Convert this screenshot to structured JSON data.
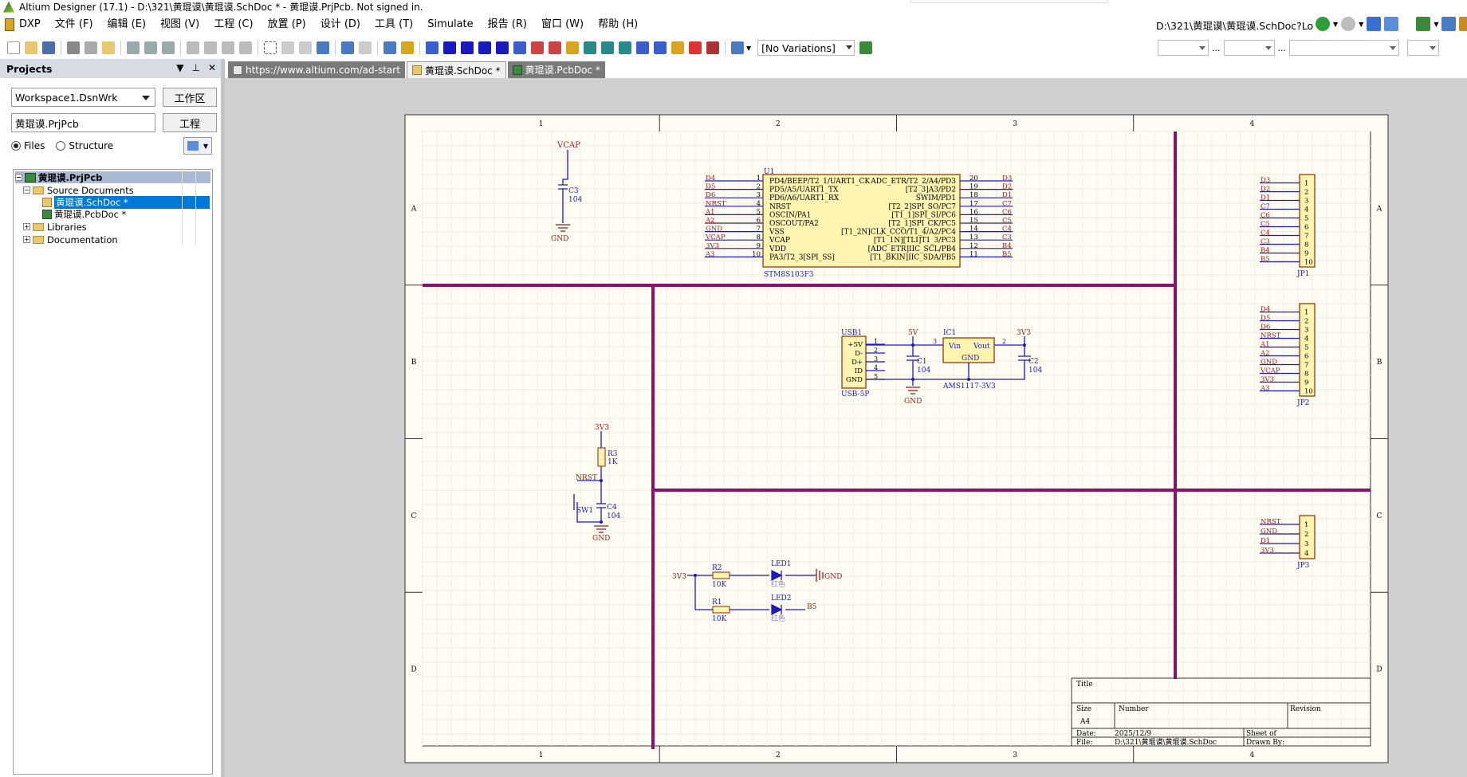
{
  "window": {
    "title": "Altium Designer (17.1) - D:\\321\\黄琨谟\\黄琨谟.SchDoc * - 黄琨谟.PrjPcb. Not signed in."
  },
  "menu": [
    "DXP",
    "文件 (F)",
    "编辑 (E)",
    "视图 (V)",
    "工程 (C)",
    "放置 (P)",
    "设计 (D)",
    "工具 (T)",
    "Simulate",
    "报告 (R)",
    "窗口 (W)",
    "帮助 (H)"
  ],
  "nav_path": "D:\\321\\黄琨谟\\黄琨谟.SchDoc?Lo",
  "toolbar": {
    "variations": "[No Variations]"
  },
  "projects_panel": {
    "title": "Projects",
    "workspace": "Workspace1.DsnWrk",
    "workspace_button": "工作区",
    "project": "黄琨谟.PrjPcb",
    "project_button": "工程",
    "radio_files": "Files",
    "radio_structure": "Structure",
    "tree": {
      "root": "黄琨谟.PrjPcb",
      "source_documents": "Source Documents",
      "schdoc": "黄琨谟.SchDoc *",
      "pcbdoc": "黄琨谟.PcbDoc *",
      "libraries": "Libraries",
      "documentation": "Documentation"
    }
  },
  "tabs": [
    {
      "label": "https://www.altium.com/ad-start"
    },
    {
      "label": "黄琨谟.SchDoc *"
    },
    {
      "label": "黄琨谟.PcbDoc *"
    }
  ],
  "schematic": {
    "cols": [
      "1",
      "2",
      "3",
      "4"
    ],
    "rows": [
      "A",
      "B",
      "C",
      "D"
    ],
    "mcu": {
      "ref": "U1",
      "part": "STM8S103F3",
      "left_pins": [
        "PD4/BEEP/T2_1/UART1_CK",
        "PD5/A5/UART1_TX",
        "PD6/A6/UART1_RX",
        "NRST",
        "OSCIN/PA1",
        "OSCOUT/PA2",
        "VSS",
        "VCAP",
        "VDD",
        "PA3/T2_3[SPI_SS]"
      ],
      "left_nums": [
        "1",
        "2",
        "3",
        "4",
        "5",
        "6",
        "7",
        "8",
        "9",
        "10"
      ],
      "left_nets": [
        "D4",
        "D5",
        "D6",
        "NRST",
        "A1",
        "A2",
        "GND",
        "VCAP",
        "3V3",
        "A3"
      ],
      "right_pins": [
        "ADC_ETR/T2_2/A4/PD3",
        "[T2_3]A3/PD2",
        "[T2_3]A3/PD2",
        "SWIM/PD1",
        "[T2_2]SPI_SO/PC7",
        "[T1_1]SPI_SI/PC6",
        "[T2_1]SPI_CK/PC5",
        "[T1_2N]CLK_CCO/T1_4/A2/PC4",
        "[T1_1N][TLI]T1_3/PC3",
        "[ADC_ETR]IIC_SCL/PB4",
        "[T1_BKIN]IIC_SDA/PB5"
      ],
      "right_nums": [
        "20",
        "19",
        "18",
        "17",
        "16",
        "15",
        "14",
        "13",
        "12",
        "11"
      ],
      "right_nets": [
        "D3",
        "D2",
        "D1",
        "C7",
        "C6",
        "C5",
        "C4",
        "C3",
        "B4",
        "B5"
      ]
    },
    "c3": {
      "net": "VCAP",
      "ref": "C3",
      "val": "104",
      "gnd": "GND"
    },
    "jp1": {
      "ref": "JP1",
      "nets": [
        "D3",
        "D2",
        "D1",
        "C7",
        "C6",
        "C5",
        "C4",
        "C3",
        "B4",
        "B5"
      ],
      "nums": [
        "1",
        "2",
        "3",
        "4",
        "5",
        "6",
        "7",
        "8",
        "9",
        "10"
      ]
    },
    "jp2": {
      "ref": "JP2",
      "nets": [
        "D4",
        "D5",
        "D6",
        "NRST",
        "A1",
        "A2",
        "GND",
        "VCAP",
        "3V3",
        "A3"
      ],
      "nums": [
        "1",
        "2",
        "3",
        "4",
        "5",
        "6",
        "7",
        "8",
        "9",
        "10"
      ]
    },
    "jp3": {
      "ref": "JP3",
      "nets": [
        "NRST",
        "GND",
        "D1",
        "3V3"
      ],
      "nums": [
        "1",
        "2",
        "3",
        "4"
      ]
    },
    "usb": {
      "ref": "USB1",
      "part": "USB-5P",
      "pins": [
        "+5V",
        "D-",
        "D+",
        "ID",
        "GND"
      ],
      "nums": [
        "1",
        "2",
        "3",
        "4",
        "5"
      ]
    },
    "power": {
      "net5v": "5V",
      "c1": "C1",
      "c1v": "104",
      "gnd": "GND",
      "ic": "IC1",
      "icpart": "AMS1117-3V3",
      "vin": "Vin",
      "vout": "Vout",
      "icgnd": "GND",
      "pin3": "3",
      "pin2": "2",
      "pin1": "1",
      "net3v3": "3V3",
      "c2": "C2",
      "c2v": "104"
    },
    "reset": {
      "net": "3V3",
      "r3": "R3",
      "r3v": "1K",
      "nrst": "NRST",
      "sw": "SW1",
      "c4": "C4",
      "c4v": "104",
      "gnd": "GND"
    },
    "led": {
      "net": "3V3",
      "r2": "R2",
      "r2v": "10K",
      "r1": "R1",
      "r1v": "10K",
      "led1": "LED1",
      "led2": "LED2",
      "color1": "红色",
      "color2": "红色",
      "gnd": "GND",
      "b5": "B5"
    },
    "titleblock": {
      "title": "Title",
      "size": "Size",
      "sizeval": "A4",
      "number": "Number",
      "revision": "Revision",
      "date": "Date:",
      "dateval": "2025/12/9",
      "file": "File:",
      "fileval": "D:\\321\\黄琨谟\\黄琨谟.SchDoc",
      "sheet": "Sheet   of",
      "drawn": "Drawn By:"
    }
  },
  "colors": {
    "wire": "#1b1bbb",
    "net": "#9b1c1c",
    "border": "#7a0f6e",
    "comp_fill": "#fff4b0",
    "comp_stroke": "#8a2a00",
    "sheet_bg": "#fffdf3"
  }
}
